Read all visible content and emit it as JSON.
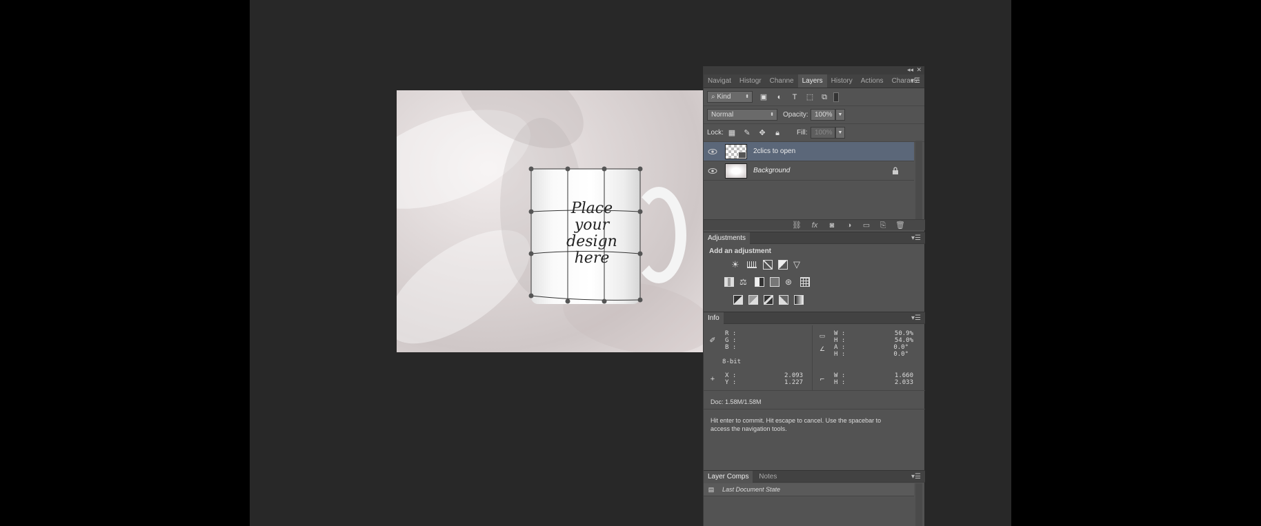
{
  "canvas": {
    "mug_text": [
      "Place",
      "your",
      "design",
      "here"
    ]
  },
  "panel": {
    "top_bar": {
      "collapse": "◂◂",
      "close": "✕"
    },
    "tabs": [
      "Navigat",
      "Histogr",
      "Channe",
      "Layers",
      "History",
      "Actions",
      "Characte"
    ],
    "active_tab": "Layers",
    "filter": {
      "kind": "Kind"
    },
    "blend_mode": "Normal",
    "opacity_label": "Opacity:",
    "opacity_value": "100%",
    "lock_label": "Lock:",
    "fill_label": "Fill:",
    "fill_value": "100%",
    "layers": [
      {
        "name": "2clics to open",
        "selected": true,
        "locked": false
      },
      {
        "name": "Background",
        "selected": false,
        "locked": true
      }
    ]
  },
  "adjustments": {
    "title": "Adjustments",
    "heading": "Add an adjustment",
    "row1": [
      "brightness-contrast-icon",
      "levels-icon",
      "curves-icon",
      "exposure-icon",
      "gradient-map-triangle-icon"
    ],
    "row2": [
      "vibrance-icon",
      "color-balance-icon",
      "black-white-icon",
      "photo-filter-icon",
      "channel-mixer-icon",
      "color-lookup-icon"
    ],
    "row3": [
      "invert-icon",
      "posterize-icon",
      "threshold-icon",
      "selective-color-icon",
      "gradient-map-icon"
    ]
  },
  "info": {
    "title": "Info",
    "r_label": "R :",
    "g_label": "G :",
    "b_label": "B :",
    "bit_depth": "8-bit",
    "w_label": "W :",
    "h_label": "H :",
    "a_label": "A :",
    "h2_label": "H :",
    "w_pct": "50.9%",
    "h_pct": "54.0%",
    "a_val": "0.0°",
    "h2_val": "0.0°",
    "x_label": "X :",
    "y_label": "Y :",
    "x_val": "2.093",
    "y_val": "1.227",
    "w2_label": "W :",
    "h3_label": "H :",
    "w2_val": "1.660",
    "h3_val": "2.033",
    "doc": "Doc: 1.58M/1.58M",
    "hint": "Hit enter to commit. Hit escape to cancel. Use the spacebar to access the navigation tools."
  },
  "comps": {
    "tabs": [
      "Layer Comps",
      "Notes"
    ],
    "item": "Last Document State"
  }
}
